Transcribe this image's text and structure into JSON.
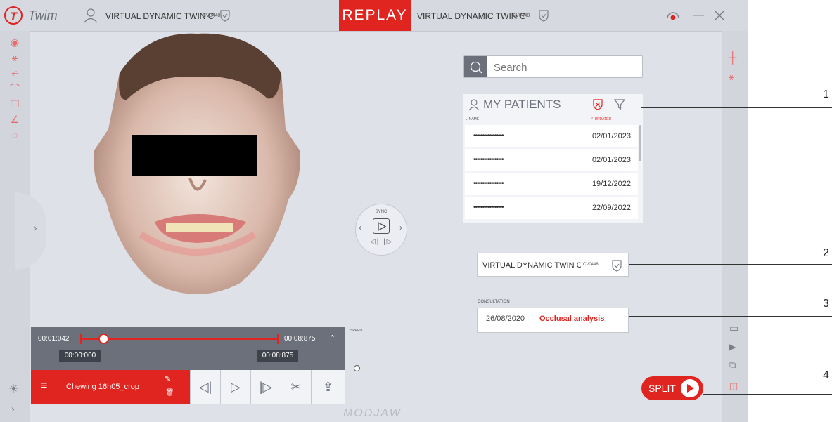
{
  "topbar": {
    "logo_letter": "T",
    "brand": "Twim",
    "left_case_title": "VIRTUAL DYNAMIC TWIN C",
    "left_case_code": "CV0448",
    "mode": "REPLAY",
    "right_case_title": "VIRTUAL DYNAMIC TWIN C",
    "right_case_code": "CV0448"
  },
  "search": {
    "placeholder": "Search"
  },
  "patients": {
    "title": "MY PATIENTS",
    "col_name": "NAME",
    "col_updated": "UPDATED",
    "rows": [
      {
        "name": "•••••••••••••••••",
        "date": "02/01/2023"
      },
      {
        "name": "•••••••••••••••••",
        "date": "02/01/2023"
      },
      {
        "name": "•••••••••••••••••",
        "date": "19/12/2022"
      },
      {
        "name": "•••••••••••••••••",
        "date": "22/09/2022"
      }
    ]
  },
  "case": {
    "title": "VIRTUAL DYNAMIC TWIN CAS",
    "code": "CV0448"
  },
  "consultation": {
    "label": "CONSULTATION",
    "date": "26/08/2020",
    "type": "Occlusal analysis"
  },
  "sync": {
    "label": "SYNC"
  },
  "timeline": {
    "start_time": "00:01:042",
    "end_time": "00:08:875",
    "marker_left": "00:00:000",
    "marker_right": "00:08:875",
    "progress": 0.1
  },
  "speed": {
    "label": "SPEED"
  },
  "recording": {
    "name": "Chewing 16h05_crop"
  },
  "split_button": {
    "label": "SPLIT"
  },
  "watermark": "MODJAW",
  "annotations": [
    "1",
    "2",
    "3",
    "4"
  ],
  "colors": {
    "accent": "#e0241f",
    "panel": "#dfe1e8",
    "dark": "#6b707b"
  }
}
